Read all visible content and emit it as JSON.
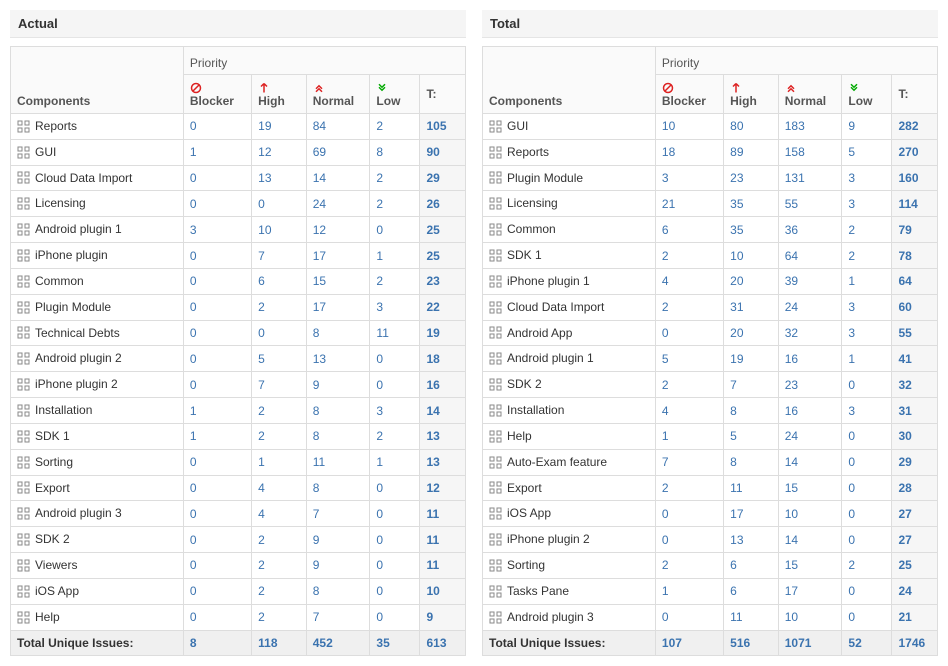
{
  "labels": {
    "components": "Components",
    "priority": "Priority",
    "blocker": "Blocker",
    "high": "High",
    "normal": "Normal",
    "low": "Low",
    "t": "T:",
    "total_row": "Total Unique Issues:"
  },
  "icons": {
    "blocker": "blocker-icon",
    "high": "high-icon",
    "normal": "normal-icon",
    "low": "low-icon",
    "component": "component-icon"
  },
  "panels": [
    {
      "key": "actual",
      "title": "Actual",
      "rows": [
        {
          "name": "Reports",
          "blocker": 0,
          "high": 19,
          "normal": 84,
          "low": 2,
          "t": 105
        },
        {
          "name": "GUI",
          "blocker": 1,
          "high": 12,
          "normal": 69,
          "low": 8,
          "t": 90
        },
        {
          "name": "Cloud Data Import",
          "blocker": 0,
          "high": 13,
          "normal": 14,
          "low": 2,
          "t": 29
        },
        {
          "name": "Licensing",
          "blocker": 0,
          "high": 0,
          "normal": 24,
          "low": 2,
          "t": 26
        },
        {
          "name": "Android plugin 1",
          "blocker": 3,
          "high": 10,
          "normal": 12,
          "low": 0,
          "t": 25
        },
        {
          "name": "iPhone plugin",
          "blocker": 0,
          "high": 7,
          "normal": 17,
          "low": 1,
          "t": 25
        },
        {
          "name": "Common",
          "blocker": 0,
          "high": 6,
          "normal": 15,
          "low": 2,
          "t": 23
        },
        {
          "name": "Plugin Module",
          "blocker": 0,
          "high": 2,
          "normal": 17,
          "low": 3,
          "t": 22
        },
        {
          "name": "Technical Debts",
          "blocker": 0,
          "high": 0,
          "normal": 8,
          "low": 11,
          "t": 19
        },
        {
          "name": "Android plugin 2",
          "blocker": 0,
          "high": 5,
          "normal": 13,
          "low": 0,
          "t": 18
        },
        {
          "name": "iPhone plugin 2",
          "blocker": 0,
          "high": 7,
          "normal": 9,
          "low": 0,
          "t": 16
        },
        {
          "name": "Installation",
          "blocker": 1,
          "high": 2,
          "normal": 8,
          "low": 3,
          "t": 14
        },
        {
          "name": "SDK 1",
          "blocker": 1,
          "high": 2,
          "normal": 8,
          "low": 2,
          "t": 13
        },
        {
          "name": "Sorting",
          "blocker": 0,
          "high": 1,
          "normal": 11,
          "low": 1,
          "t": 13
        },
        {
          "name": "Export",
          "blocker": 0,
          "high": 4,
          "normal": 8,
          "low": 0,
          "t": 12
        },
        {
          "name": "Android plugin 3",
          "blocker": 0,
          "high": 4,
          "normal": 7,
          "low": 0,
          "t": 11
        },
        {
          "name": "SDK 2",
          "blocker": 0,
          "high": 2,
          "normal": 9,
          "low": 0,
          "t": 11
        },
        {
          "name": "Viewers",
          "blocker": 0,
          "high": 2,
          "normal": 9,
          "low": 0,
          "t": 11
        },
        {
          "name": "iOS App",
          "blocker": 0,
          "high": 2,
          "normal": 8,
          "low": 0,
          "t": 10
        },
        {
          "name": "Help",
          "blocker": 0,
          "high": 2,
          "normal": 7,
          "low": 0,
          "t": 9
        }
      ],
      "total": {
        "blocker": 8,
        "high": 118,
        "normal": 452,
        "low": 35,
        "t": 613
      }
    },
    {
      "key": "total",
      "title": "Total",
      "rows": [
        {
          "name": "GUI",
          "blocker": 10,
          "high": 80,
          "normal": 183,
          "low": 9,
          "t": 282
        },
        {
          "name": "Reports",
          "blocker": 18,
          "high": 89,
          "normal": 158,
          "low": 5,
          "t": 270
        },
        {
          "name": "Plugin Module",
          "blocker": 3,
          "high": 23,
          "normal": 131,
          "low": 3,
          "t": 160
        },
        {
          "name": "Licensing",
          "blocker": 21,
          "high": 35,
          "normal": 55,
          "low": 3,
          "t": 114
        },
        {
          "name": "Common",
          "blocker": 6,
          "high": 35,
          "normal": 36,
          "low": 2,
          "t": 79
        },
        {
          "name": "SDK 1",
          "blocker": 2,
          "high": 10,
          "normal": 64,
          "low": 2,
          "t": 78
        },
        {
          "name": "iPhone plugin 1",
          "blocker": 4,
          "high": 20,
          "normal": 39,
          "low": 1,
          "t": 64
        },
        {
          "name": "Cloud Data Import",
          "blocker": 2,
          "high": 31,
          "normal": 24,
          "low": 3,
          "t": 60
        },
        {
          "name": "Android App",
          "blocker": 0,
          "high": 20,
          "normal": 32,
          "low": 3,
          "t": 55
        },
        {
          "name": "Android plugin 1",
          "blocker": 5,
          "high": 19,
          "normal": 16,
          "low": 1,
          "t": 41
        },
        {
          "name": "SDK 2",
          "blocker": 2,
          "high": 7,
          "normal": 23,
          "low": 0,
          "t": 32
        },
        {
          "name": "Installation",
          "blocker": 4,
          "high": 8,
          "normal": 16,
          "low": 3,
          "t": 31
        },
        {
          "name": "Help",
          "blocker": 1,
          "high": 5,
          "normal": 24,
          "low": 0,
          "t": 30
        },
        {
          "name": "Auto-Exam feature",
          "blocker": 7,
          "high": 8,
          "normal": 14,
          "low": 0,
          "t": 29
        },
        {
          "name": "Export",
          "blocker": 2,
          "high": 11,
          "normal": 15,
          "low": 0,
          "t": 28
        },
        {
          "name": "iOS App",
          "blocker": 0,
          "high": 17,
          "normal": 10,
          "low": 0,
          "t": 27
        },
        {
          "name": "iPhone plugin 2",
          "blocker": 0,
          "high": 13,
          "normal": 14,
          "low": 0,
          "t": 27
        },
        {
          "name": "Sorting",
          "blocker": 2,
          "high": 6,
          "normal": 15,
          "low": 2,
          "t": 25
        },
        {
          "name": "Tasks Pane",
          "blocker": 1,
          "high": 6,
          "normal": 17,
          "low": 0,
          "t": 24
        },
        {
          "name": "Android plugin 3",
          "blocker": 0,
          "high": 11,
          "normal": 10,
          "low": 0,
          "t": 21
        }
      ],
      "total": {
        "blocker": 107,
        "high": 516,
        "normal": 1071,
        "low": 52,
        "t": 1746
      }
    }
  ]
}
